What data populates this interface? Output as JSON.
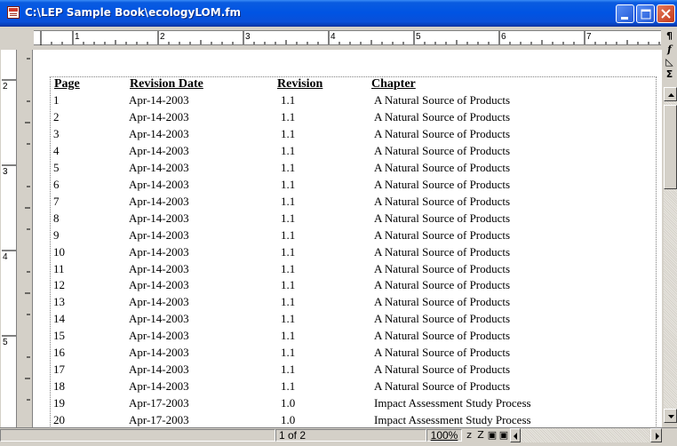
{
  "window": {
    "title": "C:\\LEP Sample Book\\ecologyLOM.fm"
  },
  "ruler": {
    "h_marks": [
      "1",
      "2",
      "3",
      "4",
      "5",
      "6",
      "7"
    ],
    "v_marks": [
      "2",
      "3",
      "4",
      "5"
    ]
  },
  "table": {
    "headers": {
      "page": "Page",
      "revision_date": "Revision Date",
      "revision": "Revision",
      "chapter": "Chapter"
    },
    "rows": [
      {
        "page": "1",
        "date": "Apr-14-2003",
        "rev": "1.1",
        "chapter": "A Natural Source of Products"
      },
      {
        "page": "2",
        "date": "Apr-14-2003",
        "rev": "1.1",
        "chapter": "A Natural Source of Products"
      },
      {
        "page": "3",
        "date": "Apr-14-2003",
        "rev": "1.1",
        "chapter": "A Natural Source of Products"
      },
      {
        "page": "4",
        "date": "Apr-14-2003",
        "rev": "1.1",
        "chapter": "A Natural Source of Products"
      },
      {
        "page": "5",
        "date": "Apr-14-2003",
        "rev": "1.1",
        "chapter": "A Natural Source of Products"
      },
      {
        "page": "6",
        "date": "Apr-14-2003",
        "rev": "1.1",
        "chapter": "A Natural Source of Products"
      },
      {
        "page": "7",
        "date": "Apr-14-2003",
        "rev": "1.1",
        "chapter": "A Natural Source of Products"
      },
      {
        "page": "8",
        "date": "Apr-14-2003",
        "rev": "1.1",
        "chapter": "A Natural Source of Products"
      },
      {
        "page": "9",
        "date": "Apr-14-2003",
        "rev": "1.1",
        "chapter": "A Natural Source of Products"
      },
      {
        "page": "10",
        "date": "Apr-14-2003",
        "rev": "1.1",
        "chapter": "A Natural Source of Products"
      },
      {
        "page": "11",
        "date": "Apr-14-2003",
        "rev": "1.1",
        "chapter": "A Natural Source of Products"
      },
      {
        "page": "12",
        "date": "Apr-14-2003",
        "rev": "1.1",
        "chapter": "A Natural Source of Products"
      },
      {
        "page": "13",
        "date": "Apr-14-2003",
        "rev": "1.1",
        "chapter": "A Natural Source of Products"
      },
      {
        "page": "14",
        "date": "Apr-14-2003",
        "rev": "1.1",
        "chapter": "A Natural Source of Products"
      },
      {
        "page": "15",
        "date": "Apr-14-2003",
        "rev": "1.1",
        "chapter": "A Natural Source of Products"
      },
      {
        "page": "16",
        "date": "Apr-14-2003",
        "rev": "1.1",
        "chapter": "A Natural Source of Products"
      },
      {
        "page": "17",
        "date": "Apr-14-2003",
        "rev": "1.1",
        "chapter": "A Natural Source of Products"
      },
      {
        "page": "18",
        "date": "Apr-14-2003",
        "rev": "1.1",
        "chapter": "A Natural Source of Products"
      },
      {
        "page": "19",
        "date": "Apr-17-2003",
        "rev": "1.0",
        "chapter": "Impact Assessment Study Process"
      },
      {
        "page": "20",
        "date": "Apr-17-2003",
        "rev": "1.0",
        "chapter": "Impact Assessment Study Process"
      }
    ]
  },
  "side_tools": {
    "paragraph": "¶",
    "function": "f",
    "triangle": "◺",
    "sigma": "Σ"
  },
  "status": {
    "page_of": "1 of 2",
    "zoom": "100%",
    "zoom_out": "z",
    "zoom_in": "Z",
    "fit_page": "▣",
    "fit_window": "▣"
  },
  "icons": [
    "framemaker-doc-icon",
    "minimize-icon",
    "maximize-icon",
    "close-icon",
    "scroll-up-icon",
    "scroll-down-icon",
    "scroll-left-icon",
    "scroll-right-icon"
  ]
}
